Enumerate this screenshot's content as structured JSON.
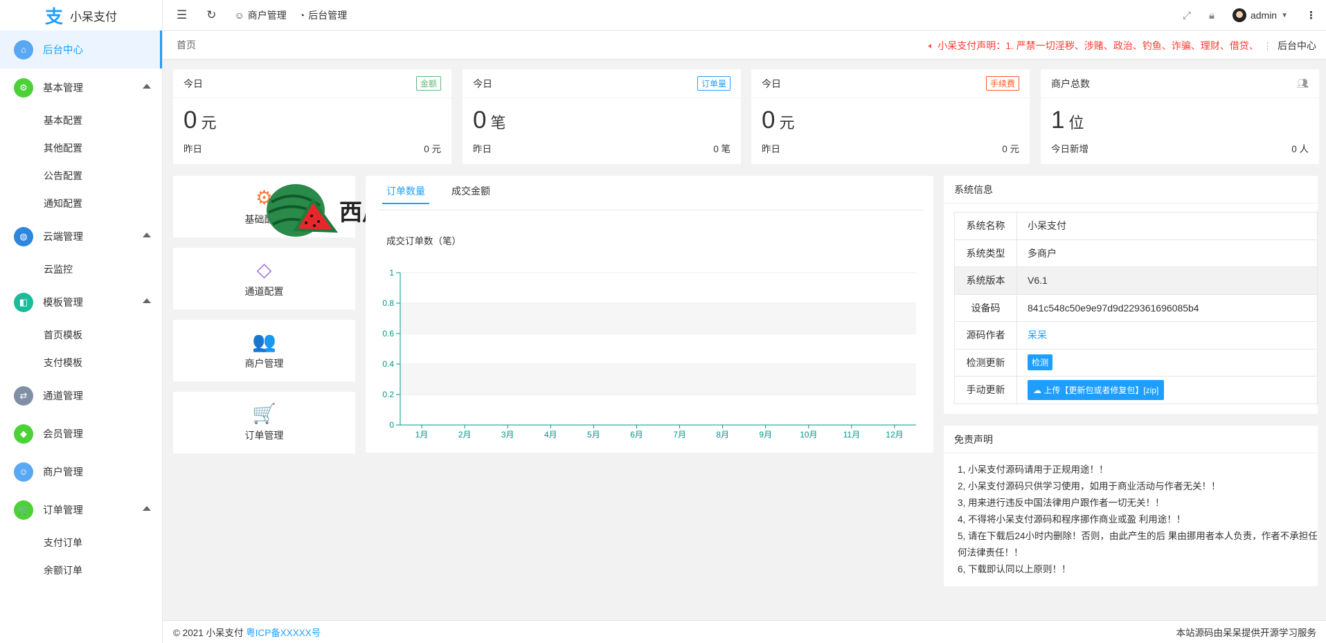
{
  "app": {
    "name": "小呆支付"
  },
  "sidebar": {
    "items": [
      {
        "label": "后台中心",
        "color": "#58a8f4",
        "icon": "home-icon",
        "glyph": "⌂"
      },
      {
        "label": "基本管理",
        "color": "#4cd137",
        "icon": "settings-icon",
        "glyph": "⚙",
        "sub": [
          "基本配置",
          "其他配置",
          "公告配置",
          "通知配置"
        ]
      },
      {
        "label": "云端管理",
        "color": "#2e86de",
        "icon": "globe-icon",
        "glyph": "◍",
        "sub": [
          "云监控"
        ]
      },
      {
        "label": "模板管理",
        "color": "#1abc9c",
        "icon": "layers-icon",
        "glyph": "◧",
        "sub": [
          "首页模板",
          "支付模板"
        ]
      },
      {
        "label": "通道管理",
        "color": "#7f8fa6",
        "icon": "channel-icon",
        "glyph": "⇄"
      },
      {
        "label": "会员管理",
        "color": "#4cd137",
        "icon": "diamond-icon",
        "glyph": "◆"
      },
      {
        "label": "商户管理",
        "color": "#58a8f4",
        "icon": "user-icon",
        "glyph": "☺"
      },
      {
        "label": "订单管理",
        "color": "#4cd137",
        "icon": "cart-icon",
        "glyph": "🛒",
        "sub": [
          "支付订单",
          "余额订单"
        ]
      }
    ]
  },
  "header": {
    "merchant": "商户管理",
    "backend": "后台管理",
    "user": "admin"
  },
  "breadcrumb": {
    "home": "首页",
    "notice": "小呆支付声明：1. 严禁一切淫秽、涉赌、政治、钓鱼、诈骗、理财、借贷、",
    "right": "后台中心"
  },
  "stats": [
    {
      "title": "今日",
      "badge": "金额",
      "badge_color": "#5fb878",
      "value": "0",
      "unit": "元",
      "foot_label": "昨日",
      "foot_value": "0 元"
    },
    {
      "title": "今日",
      "badge": "订单量",
      "badge_color": "#1e9fff",
      "value": "0",
      "unit": "笔",
      "foot_label": "昨日",
      "foot_value": "0 笔"
    },
    {
      "title": "今日",
      "badge": "手续费",
      "badge_color": "#ff5722",
      "value": "0",
      "unit": "元",
      "foot_label": "昨日",
      "foot_value": "0 元"
    },
    {
      "title": "商户总数",
      "badge": "",
      "badge_color": "",
      "value": "1",
      "unit": "位",
      "foot_label": "今日新增",
      "foot_value": "0 人"
    }
  ],
  "quick": [
    {
      "label": "基础配置",
      "color": "#ff7b3a",
      "glyph": "⚙"
    },
    {
      "label": "通道配置",
      "color": "#a46bdb",
      "glyph": "◇"
    },
    {
      "label": "商户管理",
      "color": "#4aa3f0",
      "glyph": "👥"
    },
    {
      "label": "订单管理",
      "color": "#5fb878",
      "glyph": "🛒"
    }
  ],
  "chart": {
    "tabs": [
      "订单数量",
      "成交金额"
    ],
    "title": "成交订单数（笔）"
  },
  "chart_data": {
    "type": "bar",
    "title": "成交订单数（笔）",
    "categories": [
      "1月",
      "2月",
      "3月",
      "4月",
      "5月",
      "6月",
      "7月",
      "8月",
      "9月",
      "10月",
      "11月",
      "12月"
    ],
    "values": [
      0,
      0,
      0,
      0,
      0,
      0,
      0,
      0,
      0,
      0,
      0,
      0
    ],
    "ylim": [
      0,
      1
    ],
    "yticks": [
      "0",
      "0.2",
      "0.4",
      "0.6",
      "0.8",
      "1"
    ],
    "accent": "#009688"
  },
  "sysinfo": {
    "title": "系统信息",
    "rows": [
      {
        "k": "系统名称",
        "v": "小呆支付"
      },
      {
        "k": "系统类型",
        "v": "多商户"
      },
      {
        "k": "系统版本",
        "v": "V6.1"
      },
      {
        "k": "设备码",
        "v": "841c548c50e9e97d9d229361696085b4"
      },
      {
        "k": "源码作者",
        "v": "呆呆"
      },
      {
        "k": "检测更新",
        "v": "检测"
      },
      {
        "k": "手动更新",
        "v": "上传【更新包或者修复包】[zip]"
      }
    ]
  },
  "disclaimer": {
    "title": "免责声明",
    "lines": [
      "1, 小呆支付源码请用于正规用途！！",
      "2, 小呆支付源码只供学习使用，如用于商业活动与作者无关！！",
      "3, 用来进行违反中国法律用户跟作者一切无关！！",
      "4, 不得将小呆支付源码和程序挪作商业或盈 利用途！！",
      "5, 请在下载后24小时内删除！否则，由此产生的后 果由挪用者本人负责，作者不承担任何法律责任！！",
      "6, 下载即认同以上原则！！"
    ]
  },
  "footer": {
    "copyright": "© 2021 小呆支付",
    "icp": "粤ICP备XXXXX号",
    "right": "本站源码由呆呆提供开源学习服务"
  },
  "watermark": {
    "text": "西瓜源码"
  }
}
